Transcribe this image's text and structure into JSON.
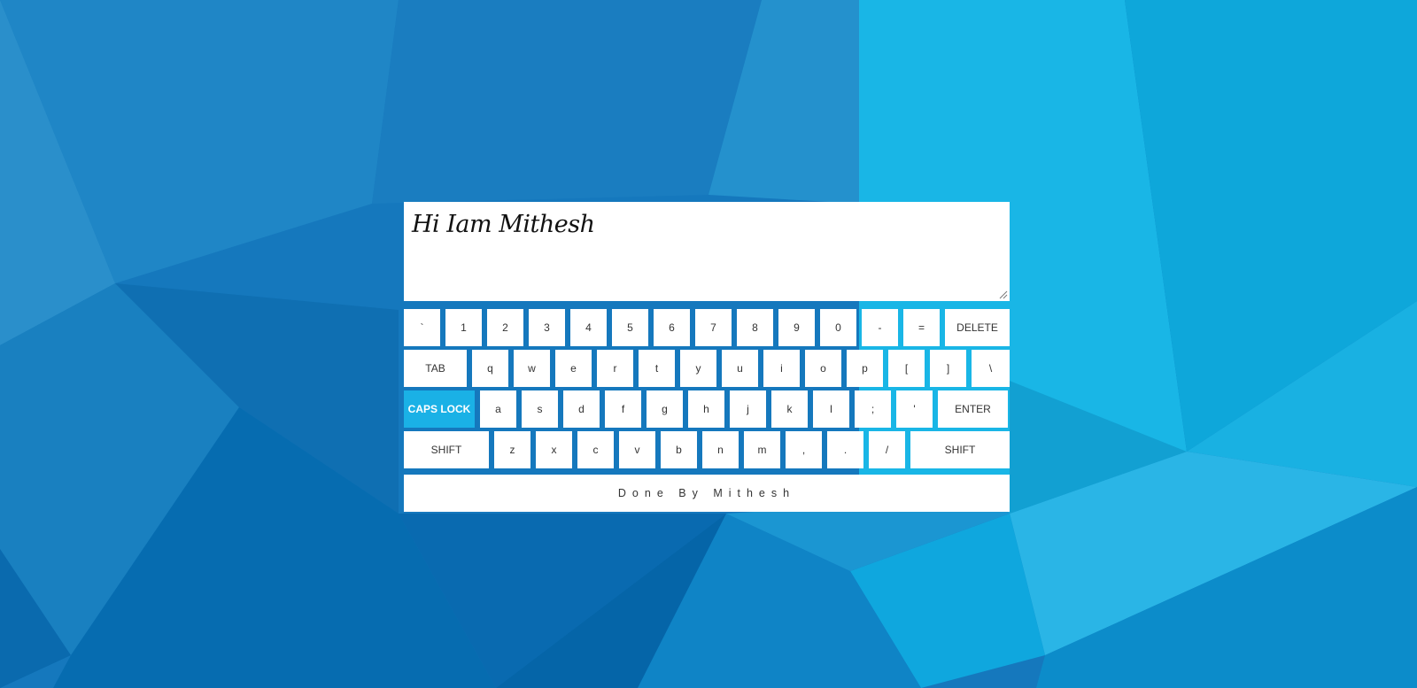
{
  "colors": {
    "background": "#1578bd",
    "key_background": "#ffffff",
    "active_key": "#1ab1e6",
    "key_text": "#333333"
  },
  "editor": {
    "text": "Hi Iam Mithesh"
  },
  "keyboard": {
    "rows": [
      [
        {
          "label": "`",
          "id": "backtick"
        },
        {
          "label": "1",
          "id": "1"
        },
        {
          "label": "2",
          "id": "2"
        },
        {
          "label": "3",
          "id": "3"
        },
        {
          "label": "4",
          "id": "4"
        },
        {
          "label": "5",
          "id": "5"
        },
        {
          "label": "6",
          "id": "6"
        },
        {
          "label": "7",
          "id": "7"
        },
        {
          "label": "8",
          "id": "8"
        },
        {
          "label": "9",
          "id": "9"
        },
        {
          "label": "0",
          "id": "0"
        },
        {
          "label": "-",
          "id": "minus"
        },
        {
          "label": "=",
          "id": "equals"
        },
        {
          "label": "DELETE",
          "id": "delete"
        }
      ],
      [
        {
          "label": "TAB",
          "id": "tab"
        },
        {
          "label": "q",
          "id": "q"
        },
        {
          "label": "w",
          "id": "w"
        },
        {
          "label": "e",
          "id": "e"
        },
        {
          "label": "r",
          "id": "r"
        },
        {
          "label": "t",
          "id": "t"
        },
        {
          "label": "y",
          "id": "y"
        },
        {
          "label": "u",
          "id": "u"
        },
        {
          "label": "i",
          "id": "i"
        },
        {
          "label": "o",
          "id": "o"
        },
        {
          "label": "p",
          "id": "p"
        },
        {
          "label": "[",
          "id": "left-bracket"
        },
        {
          "label": "]",
          "id": "right-bracket"
        },
        {
          "label": "\\",
          "id": "backslash"
        }
      ],
      [
        {
          "label": "CAPS LOCK",
          "id": "caps-lock",
          "active": true
        },
        {
          "label": "a",
          "id": "a"
        },
        {
          "label": "s",
          "id": "s"
        },
        {
          "label": "d",
          "id": "d"
        },
        {
          "label": "f",
          "id": "f"
        },
        {
          "label": "g",
          "id": "g"
        },
        {
          "label": "h",
          "id": "h"
        },
        {
          "label": "j",
          "id": "j"
        },
        {
          "label": "k",
          "id": "k"
        },
        {
          "label": "l",
          "id": "l"
        },
        {
          "label": ";",
          "id": "semicolon"
        },
        {
          "label": "'",
          "id": "quote"
        },
        {
          "label": "ENTER",
          "id": "enter"
        }
      ],
      [
        {
          "label": "SHIFT",
          "id": "shift-left"
        },
        {
          "label": "z",
          "id": "z"
        },
        {
          "label": "x",
          "id": "x"
        },
        {
          "label": "c",
          "id": "c"
        },
        {
          "label": "v",
          "id": "v"
        },
        {
          "label": "b",
          "id": "b"
        },
        {
          "label": "n",
          "id": "n"
        },
        {
          "label": "m",
          "id": "m"
        },
        {
          "label": ",",
          "id": "comma"
        },
        {
          "label": ".",
          "id": "period"
        },
        {
          "label": "/",
          "id": "slash"
        },
        {
          "label": "SHIFT",
          "id": "shift-right"
        }
      ]
    ]
  },
  "footer": {
    "text": "Done By Mithesh"
  }
}
